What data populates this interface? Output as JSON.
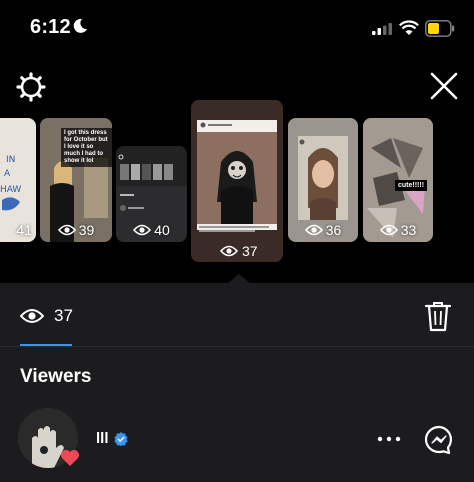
{
  "status_bar": {
    "time": "6:12"
  },
  "stories": [
    {
      "count": "41"
    },
    {
      "count": "39",
      "caption": "I got this dress for October but I love it so much I had to show it lol"
    },
    {
      "count": "40"
    },
    {
      "count": "37",
      "selected": true
    },
    {
      "count": "36"
    },
    {
      "count": "33",
      "caption": "cute!!!!!"
    }
  ],
  "sheet": {
    "view_count": "37",
    "viewers_title": "Viewers",
    "viewer": {
      "name": "lll"
    }
  },
  "colors": {
    "accent": "#3797f0",
    "heart": "#ed4956",
    "battery": "#ffd60a"
  }
}
